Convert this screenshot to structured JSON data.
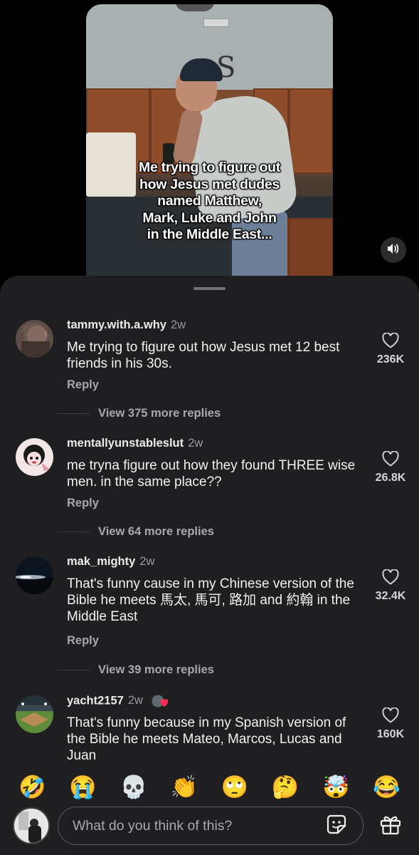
{
  "video": {
    "caption": "Me trying to figure out\nhow Jesus met dudes\nnamed Matthew,\nMark, Luke and John\nin the Middle East...",
    "volume_icon": "speaker-icon"
  },
  "comments": [
    {
      "username": "tammy.with.a.why",
      "age": "2w",
      "text": "Me trying to figure out how Jesus met 12 best friends in his 30s.",
      "reply_label": "Reply",
      "likes": "236K",
      "view_more": "View 375 more replies"
    },
    {
      "username": "mentallyunstableslut",
      "age": "2w",
      "text": "me tryna figure out how they found THREE wise men. in the same place??",
      "reply_label": "Reply",
      "likes": "26.8K",
      "view_more": "View 64 more replies"
    },
    {
      "username": "mak_mighty",
      "age": "2w",
      "text": "That's funny cause in my Chinese version of the Bible he meets 馬太, 馬可, 路加 and 約翰 in the Middle East",
      "reply_label": "Reply",
      "likes": "32.4K",
      "view_more": "View 39 more replies"
    },
    {
      "username": "yacht2157",
      "age": "2w",
      "text": "That's funny because in my Spanish version of the Bible he meets Mateo, Marcos, Lucas and Juan",
      "likes": "160K",
      "badge": "creator-liked-badge"
    }
  ],
  "emojis": [
    "🤣",
    "😭",
    "💀",
    "👏",
    "🙄",
    "🤔",
    "🤯",
    "😂"
  ],
  "composer": {
    "placeholder": "What do you think of this?",
    "sticker_icon": "sticker-icon",
    "gift_icon": "gift-icon"
  },
  "colors": {
    "sheet_bg": "#1f1f22",
    "text_primary": "#f2f2f2",
    "text_secondary": "#a9a9ad"
  }
}
